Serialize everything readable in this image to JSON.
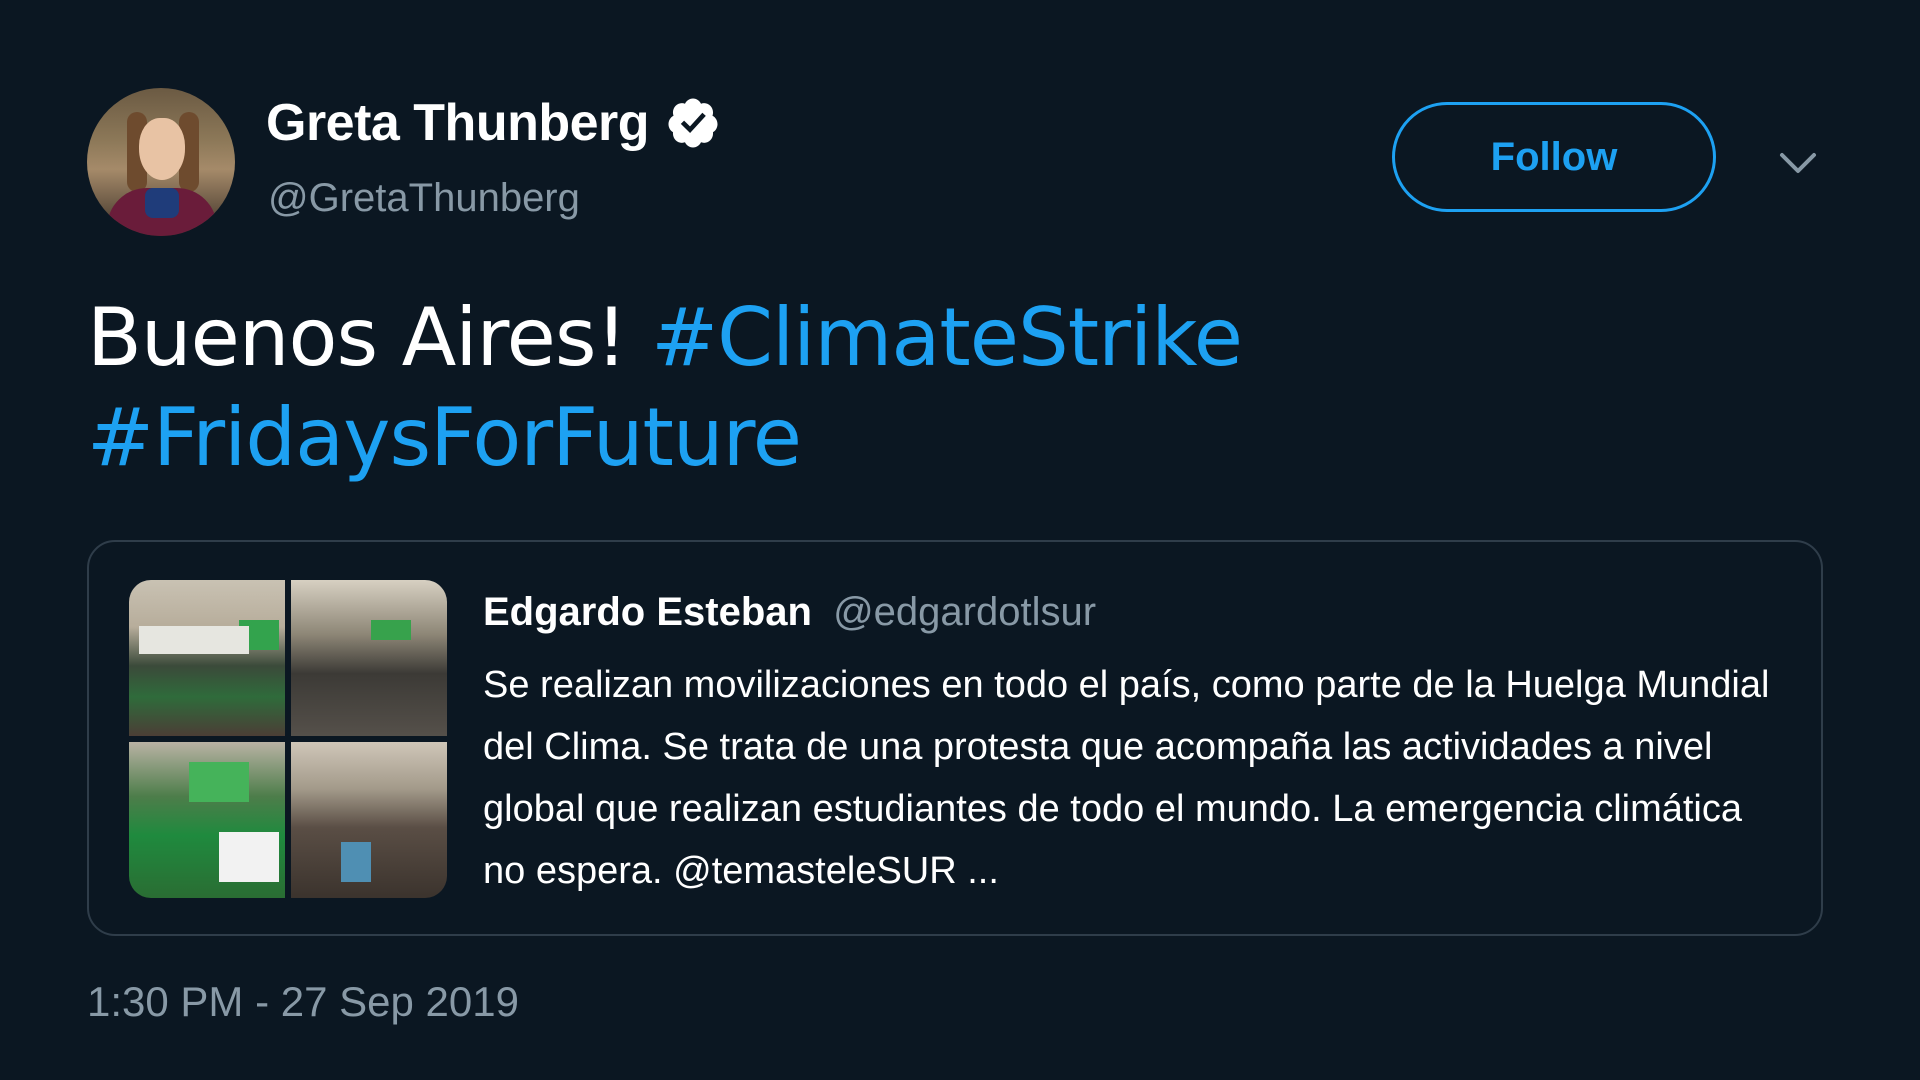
{
  "author": {
    "name": "Greta Thunberg",
    "handle": "@GretaThunberg",
    "verified": true
  },
  "actions": {
    "follow_label": "Follow"
  },
  "tweet": {
    "text_plain": "Buenos Aires!",
    "hashtags": [
      "#ClimateStrike",
      "#FridaysForFuture"
    ]
  },
  "quote": {
    "name": "Edgardo Esteban",
    "handle": "@edgardotlsur",
    "text": "Se realizan movilizaciones en todo el país, como parte de la Huelga Mundial del Clima. Se trata de una protesta que acompaña las actividades a nivel global que realizan estudiantes de todo el mundo. La emergencia climática no espera. @temasteleSUR ...",
    "media_count": 4
  },
  "timestamp": "1:30 PM - 27 Sep 2019",
  "colors": {
    "background": "#0b1722",
    "accent": "#1da1f2",
    "secondary_text": "#8899a6",
    "border": "#2f3d4a"
  },
  "icons": {
    "verified": "verified-badge-icon",
    "menu": "chevron-down-icon"
  }
}
